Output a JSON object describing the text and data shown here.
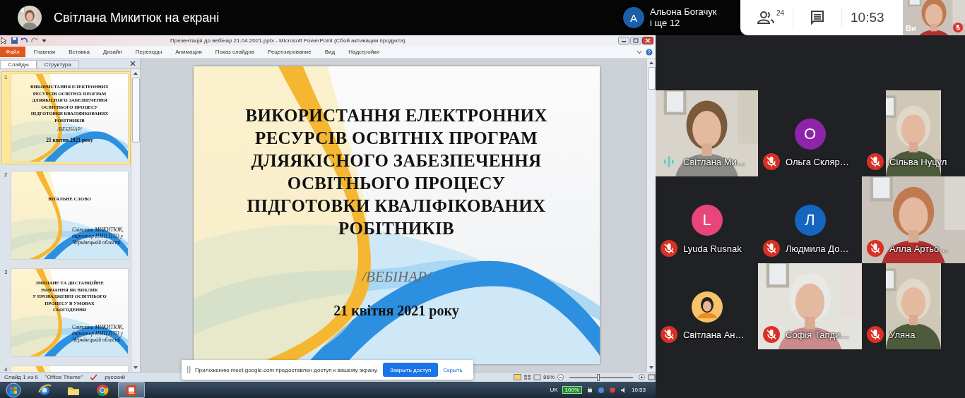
{
  "meet_header": {
    "presenter_label": "Світлана Микитюк на екрані",
    "others": {
      "initial": "A",
      "color": "#1a5fa8",
      "name": "Альона Богачук",
      "more": "і ще 12"
    },
    "people_count": "24",
    "clock": "10:53",
    "self_view": {
      "label": "Ви",
      "muted": true
    }
  },
  "powerpoint": {
    "title": "Презентація до вебінар 21.04.2021.pptx - Microsoft PowerPoint (Сбой активации продукта)",
    "file_tab": "Файл",
    "ribbon_tabs": [
      "Главная",
      "Вставка",
      "Дизайн",
      "Переходы",
      "Анимация",
      "Показ слайдов",
      "Рецензирование",
      "Вид",
      "Надстройки"
    ],
    "panel_tabs": [
      {
        "label": "Слайды",
        "selected": true
      },
      {
        "label": "Структура",
        "selected": false
      }
    ],
    "thumbnails": [
      {
        "number": "1",
        "selected": true,
        "kind": "title",
        "title_lines": [
          "ВИКОРИСТАННЯ ЕЛЕКТРОННИХ",
          "РЕСУРСІВ ОСВІТНІХ ПРОГРАМ",
          "ДЛЯЯКІСНОГО ЗАБЕЗПЕЧЕННЯ",
          "ОСВІТНЬОГО ПРОЦЕСУ",
          "ПІДГОТОВКИ КВАЛІФІКОВАНИХ",
          "РОБІТНИКІВ"
        ],
        "subtitle": "/ВЕБІНАР/",
        "date": "21 квітня 2021 року"
      },
      {
        "number": "2",
        "selected": false,
        "kind": "section",
        "title_lines": [
          "ВІТАЛЬНЕ  СЛОВО"
        ],
        "author_lines": [
          "Світлана МИКИТЮК,",
          "директор НМЦ ПТО у",
          "Чернівецькій області"
        ]
      },
      {
        "number": "3",
        "selected": false,
        "kind": "section",
        "title_lines": [
          "ЗМІШАНЕ  ТА  ДИСТАНЦІЙНЕ",
          "НАВЧАННЯ  ЯК  ВИКЛИК",
          "У ПРОВАДЖЕННІ  ОСВІТНЬОГО",
          "ПРОЦЕСУ В УМОВАХ",
          "СЬОГОДЕННЯ"
        ],
        "author_lines": [
          "Світлана МИКИТЮК,",
          "директор НМЦ ПТО у",
          "Чернівецькій області"
        ]
      },
      {
        "number": "4",
        "selected": false,
        "kind": "cut"
      }
    ],
    "slide": {
      "title_lines": [
        "ВИКОРИСТАННЯ ЕЛЕКТРОННИХ",
        "РЕСУРСІВ ОСВІТНІХ ПРОГРАМ",
        "ДЛЯЯКІСНОГО ЗАБЕЗПЕЧЕННЯ",
        "ОСВІТНЬОГО ПРОЦЕСУ",
        "ПІДГОТОВКИ КВАЛІФІКОВАНИХ",
        "РОБІТНИКІВ"
      ],
      "subtitle": "/ВЕБІНАР/",
      "date": "21 квітня 2021 року"
    },
    "status_bar": {
      "slide": "Слайд 1 из 6",
      "theme": "\"Office Theme\"",
      "language": "русский",
      "zoom": "86%",
      "zoom_slider": {
        "level": 0.45
      }
    }
  },
  "share_notice": {
    "text": "Приложению meet.google.com предоставлен доступ к вашему экрану.",
    "stop_button": "Закрыть доступ",
    "hide_link": "Скрыть"
  },
  "taskbar": {
    "apps": [
      {
        "kind": "browser",
        "selected": false
      },
      {
        "kind": "folder",
        "selected": false
      },
      {
        "kind": "chrome",
        "selected": false
      },
      {
        "kind": "powerpoint",
        "selected": true
      }
    ],
    "language": "UK",
    "battery": "100%",
    "time": "10:53"
  },
  "participants": [
    {
      "name": "Світлана Ми…",
      "kind": "video",
      "muted": false
    },
    {
      "name": "Ольга Скляр…",
      "kind": "avatar",
      "initial": "О",
      "color": "#8e24aa",
      "muted": true
    },
    {
      "name": "Сільва Нуцул",
      "kind": "portrait_video",
      "muted": true
    },
    {
      "name": "Lyuda Rusnak",
      "kind": "avatar",
      "initial": "L",
      "color": "#e8457a",
      "muted": true
    },
    {
      "name": "Людмила До…",
      "kind": "avatar",
      "initial": "Л",
      "color": "#1565c0",
      "muted": true
    },
    {
      "name": "Алла Артьо…",
      "kind": "video",
      "muted": true
    },
    {
      "name": "Світлана Ан…",
      "kind": "photo_avatar",
      "muted": true
    },
    {
      "name": "Софія Тапди…",
      "kind": "video",
      "muted": true
    },
    {
      "name": "Уляна",
      "kind": "portrait_video",
      "muted": true
    }
  ]
}
